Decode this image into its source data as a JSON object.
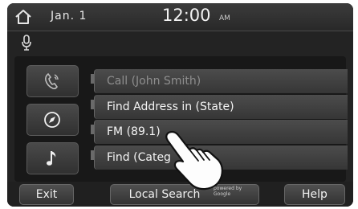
{
  "status_bar": {
    "date": "Jan. 1",
    "time": "12:00",
    "ampm": "AM"
  },
  "commands": [
    {
      "label": "Call (John Smith)",
      "icon": "phone-icon",
      "dimmed": true
    },
    {
      "label": "Find Address in (State)",
      "icon": "compass-icon",
      "dimmed": false
    },
    {
      "label": "FM (89.1)",
      "icon": "music-note-icon",
      "dimmed": false
    },
    {
      "label": "Find (Categ",
      "dimmed": false
    }
  ],
  "bottom_bar": {
    "exit_label": "Exit",
    "local_search_label": "Local Search",
    "powered_by": "powered by Google",
    "help_label": "Help"
  },
  "colors": {
    "background": "#232323",
    "button": "#3f3f3f",
    "text": "#f0f0f0",
    "dim_text": "#8e8e8e"
  }
}
